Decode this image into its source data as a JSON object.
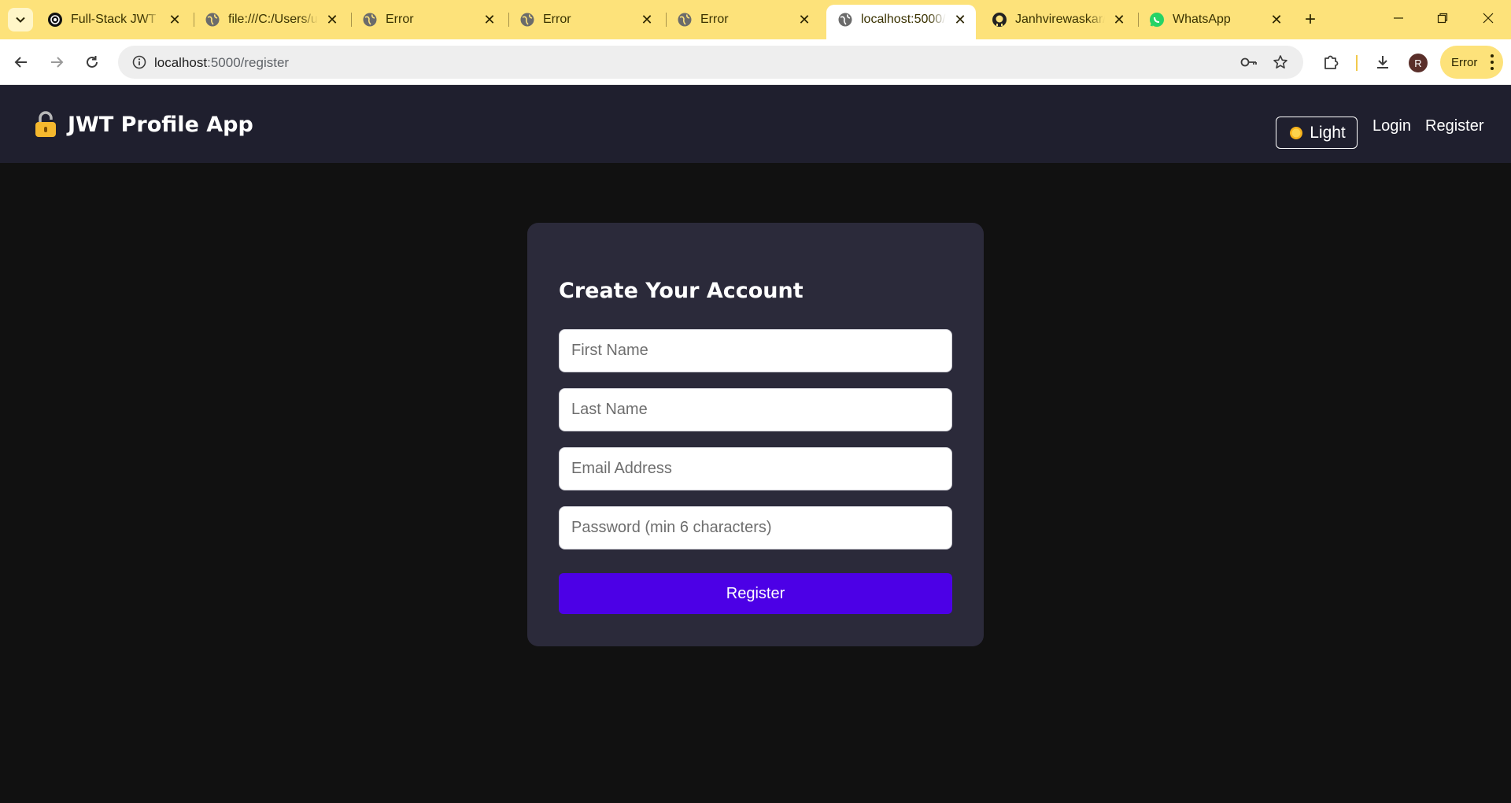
{
  "browser": {
    "tabs": [
      {
        "title": "Full-Stack JWT Pr",
        "icon": "chatgpt-icon"
      },
      {
        "title": "file:///C:/Users/u",
        "icon": "globe-icon"
      },
      {
        "title": "Error",
        "icon": "globe-icon"
      },
      {
        "title": "Error",
        "icon": "globe-icon"
      },
      {
        "title": "Error",
        "icon": "globe-icon"
      },
      {
        "title": "localhost:5000/re",
        "icon": "globe-icon",
        "active": true
      },
      {
        "title": "Janhvirewaskar/F",
        "icon": "github-icon"
      },
      {
        "title": "WhatsApp",
        "icon": "whatsapp-icon"
      }
    ],
    "url_host": "localhost",
    "url_path": ":5000/register",
    "profile_initial": "R",
    "error_chip": "Error",
    "accent_color": "#fde27a"
  },
  "app": {
    "brand": "JWT Profile App",
    "brand_icon": "lock-icon",
    "theme_toggle": "Light",
    "nav": {
      "login": "Login",
      "register": "Register"
    },
    "nav_background": "#1f1f2e"
  },
  "form": {
    "title": "Create Your Account",
    "first_name_placeholder": "First Name",
    "last_name_placeholder": "Last Name",
    "email_placeholder": "Email Address",
    "password_placeholder": "Password (min 6 characters)",
    "submit_label": "Register",
    "button_color": "#4c00e6",
    "card_color": "#2b2a3a"
  }
}
